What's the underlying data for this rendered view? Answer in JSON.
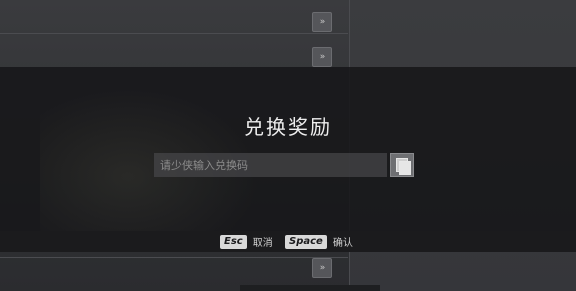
{
  "background": {
    "arrow_glyph": "»"
  },
  "dialog": {
    "title": "兑换奖励",
    "input": {
      "placeholder": "请少侠输入兑换码",
      "value": ""
    },
    "paste_icon": "paste-icon"
  },
  "footer": {
    "cancel": {
      "key": "Esc",
      "label": "取消"
    },
    "confirm": {
      "key": "Space",
      "label": "确认"
    }
  },
  "colors": {
    "overlay": "#161618",
    "footer_bar": "#1b1b1d",
    "key_bg": "#d9d9d9",
    "title_text": "#eeeeee"
  }
}
